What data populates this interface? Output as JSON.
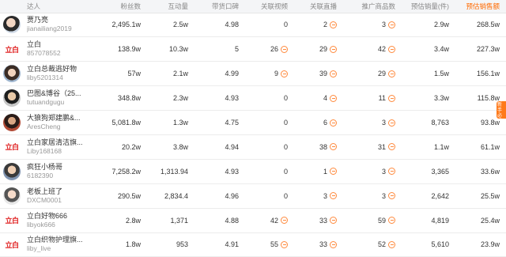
{
  "headers": [
    "达人",
    "粉丝数",
    "互动量",
    "带货口碑",
    "关联视频",
    "关联直播",
    "推广商品数",
    "预估销量(件)",
    "预估销售额"
  ],
  "float_badge": "新手必看",
  "rows": [
    {
      "avatar": "photo1",
      "name": "贾乃亮",
      "sub": "jianailiang2019",
      "fans": "2,495.1w",
      "interact": "2.5w",
      "rating": "4.98",
      "video": "0",
      "live": "2",
      "goods": "3",
      "sales": "2.9w",
      "revenue": "268.5w",
      "tags": {
        "video": false,
        "live": true,
        "goods": true
      }
    },
    {
      "avatar": "logo",
      "logo_text": "立白",
      "name": "立白",
      "sub": "857078552",
      "fans": "138.9w",
      "interact": "10.3w",
      "rating": "5",
      "video": "26",
      "live": "29",
      "goods": "42",
      "sales": "3.4w",
      "revenue": "227.3w",
      "tags": {
        "video": true,
        "live": true,
        "goods": true
      }
    },
    {
      "avatar": "photo2",
      "name": "立白总裁逃好物",
      "sub": "liby5201314",
      "fans": "57w",
      "interact": "2.1w",
      "rating": "4.99",
      "video": "9",
      "live": "39",
      "goods": "29",
      "sales": "1.5w",
      "revenue": "156.1w",
      "tags": {
        "video": true,
        "live": true,
        "goods": true
      }
    },
    {
      "avatar": "photo3",
      "name": "巴图&博谷（25...",
      "sub": "tutuandgugu",
      "fans": "348.8w",
      "interact": "2.3w",
      "rating": "4.93",
      "video": "0",
      "live": "4",
      "goods": "11",
      "sales": "3.3w",
      "revenue": "115.8w",
      "tags": {
        "video": false,
        "live": true,
        "goods": true
      }
    },
    {
      "avatar": "photo4",
      "name": "大狼狗郑建鹏&...",
      "sub": "AresCheng",
      "fans": "5,081.8w",
      "interact": "1.3w",
      "rating": "4.75",
      "video": "0",
      "live": "6",
      "goods": "3",
      "sales": "8,763",
      "revenue": "93.8w",
      "tags": {
        "video": false,
        "live": true,
        "goods": true
      }
    },
    {
      "avatar": "logo",
      "logo_text": "立白",
      "name": "立白家居清洁旗...",
      "sub": "Liby168168",
      "fans": "20.2w",
      "interact": "3.8w",
      "rating": "4.94",
      "video": "0",
      "live": "38",
      "goods": "31",
      "sales": "1.1w",
      "revenue": "61.1w",
      "tags": {
        "video": false,
        "live": true,
        "goods": true
      }
    },
    {
      "avatar": "photo5",
      "name": "疯狂小杨哥",
      "sub": "6182390",
      "fans": "7,258.2w",
      "interact": "1,313.94",
      "rating": "4.93",
      "video": "0",
      "live": "1",
      "goods": "3",
      "sales": "3,365",
      "revenue": "33.6w",
      "tags": {
        "video": false,
        "live": true,
        "goods": true
      }
    },
    {
      "avatar": "photo6",
      "name": "老板上班了",
      "sub": "DXCM0001",
      "fans": "290.5w",
      "interact": "2,834.4",
      "rating": "4.96",
      "video": "0",
      "live": "3",
      "goods": "3",
      "sales": "2,642",
      "revenue": "25.5w",
      "tags": {
        "video": false,
        "live": true,
        "goods": true
      }
    },
    {
      "avatar": "logo",
      "logo_text": "立白",
      "name": "立白好物666",
      "sub": "libyok666",
      "fans": "2.8w",
      "interact": "1,371",
      "rating": "4.88",
      "video": "42",
      "live": "33",
      "goods": "59",
      "sales": "4,819",
      "revenue": "25.4w",
      "tags": {
        "video": true,
        "live": true,
        "goods": true
      }
    },
    {
      "avatar": "logo",
      "logo_text": "立白",
      "name": "立白织物护理旗...",
      "sub": "liby_live",
      "fans": "1.8w",
      "interact": "953",
      "rating": "4.91",
      "video": "55",
      "live": "33",
      "goods": "52",
      "sales": "5,610",
      "revenue": "23.9w",
      "tags": {
        "video": true,
        "live": true,
        "goods": true
      }
    }
  ]
}
